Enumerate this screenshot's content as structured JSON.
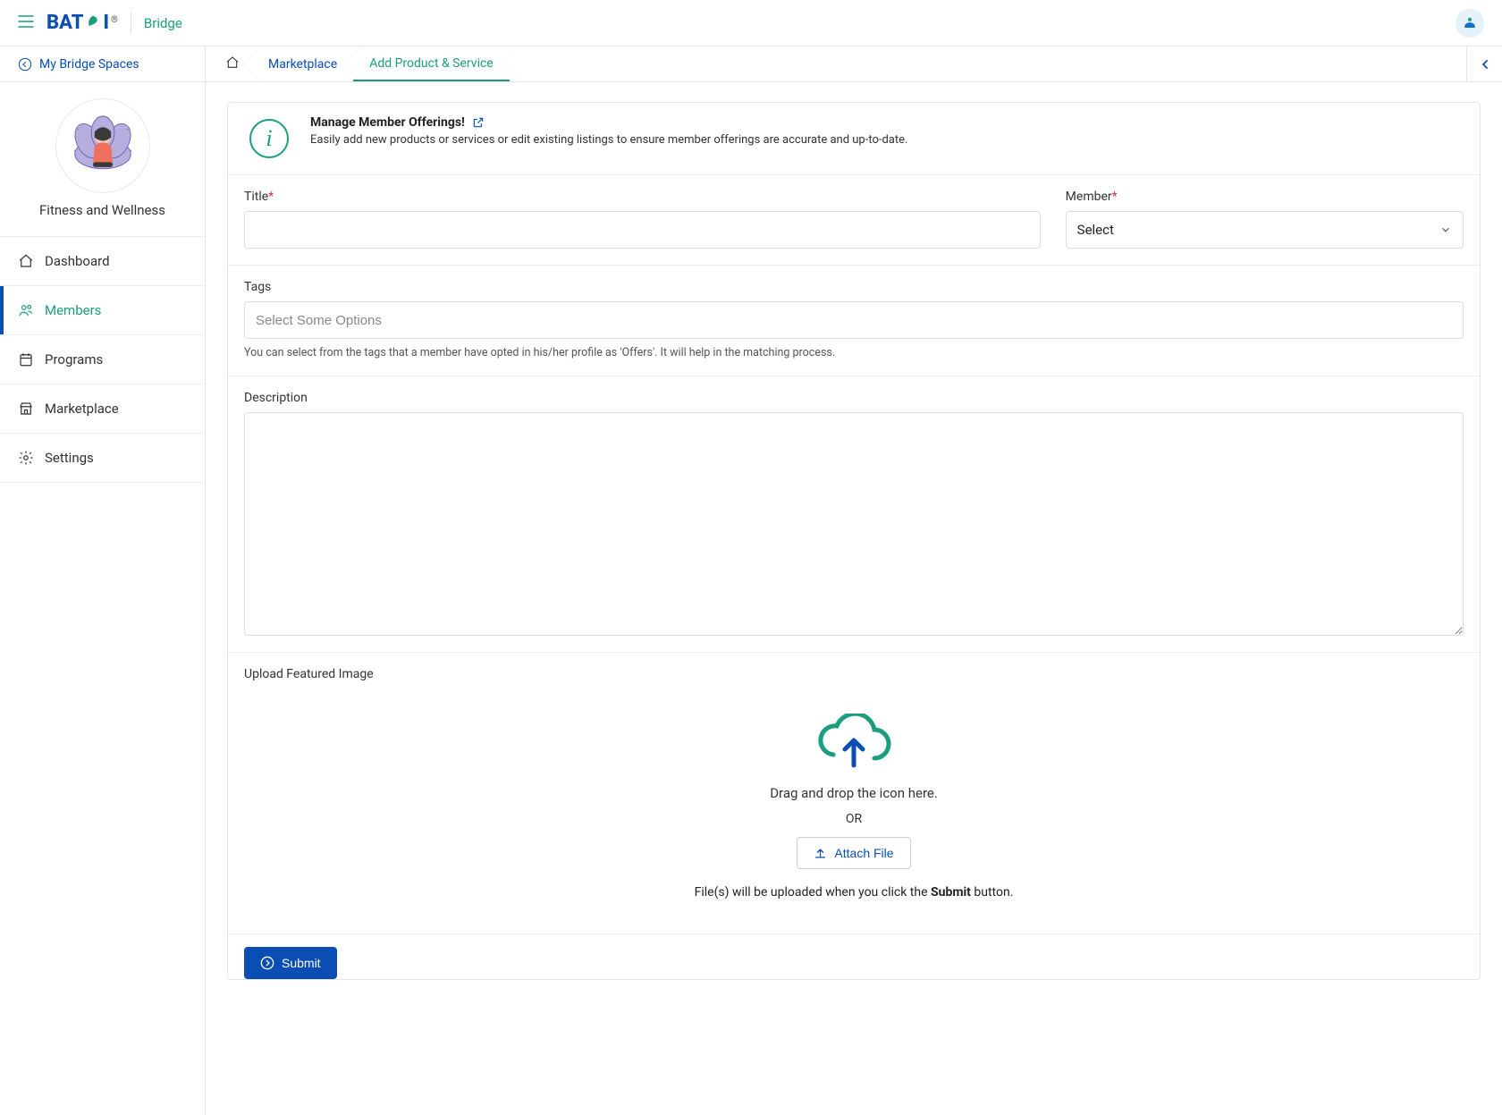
{
  "header": {
    "product_name": "Bridge"
  },
  "subheader": {
    "spaces_label": "My Bridge Spaces"
  },
  "breadcrumb": {
    "items": [
      {
        "label": "Marketplace"
      },
      {
        "label": "Add Product & Service"
      }
    ]
  },
  "workspace": {
    "name": "Fitness and Wellness"
  },
  "sidebar": {
    "items": [
      {
        "label": "Dashboard"
      },
      {
        "label": "Members"
      },
      {
        "label": "Programs"
      },
      {
        "label": "Marketplace"
      },
      {
        "label": "Settings"
      }
    ]
  },
  "info": {
    "title": "Manage Member Offerings!",
    "description": "Easily add new products or services or edit existing listings to ensure member offerings are accurate and up-to-date."
  },
  "form": {
    "title_label": "Title",
    "member_label": "Member",
    "member_selected": "Select",
    "tags_label": "Tags",
    "tags_placeholder": "Select Some Options",
    "tags_hint": "You can select from the tags that a member have opted in his/her profile as 'Offers'. It will help in the matching process.",
    "description_label": "Description",
    "upload_label": "Upload Featured Image",
    "upload_line": "Drag and drop the icon here.",
    "upload_or": "OR",
    "attach_label": "Attach File",
    "upload_note_pre": "File(s) will be uploaded when you click the ",
    "upload_note_bold": "Submit",
    "upload_note_post": " button.",
    "submit_label": "Submit"
  }
}
